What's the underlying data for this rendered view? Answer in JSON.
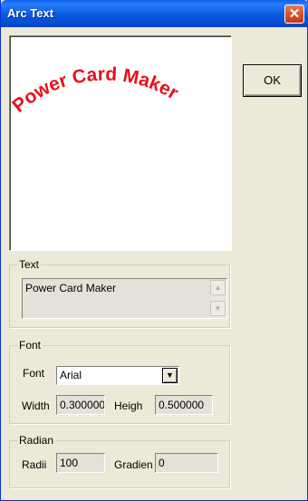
{
  "window": {
    "title": "Arc Text",
    "close_symbol": "✕"
  },
  "preview": {
    "arc_text": "Power Card Maker",
    "text_color": "#e8111b"
  },
  "ok_button": {
    "label": "OK"
  },
  "text_group": {
    "title": "Text",
    "value": "Power Card Maker",
    "scroll_up_icon": "scroll-up-arrow",
    "scroll_down_icon": "scroll-down-arrow"
  },
  "font_group": {
    "title": "Font",
    "font_label": "Font",
    "font_value": "Arial",
    "dropdown_icon": "dropdown-arrow",
    "width_label": "Width",
    "width_value": "0.300000",
    "height_label": "Height",
    "height_value": "0.500000"
  },
  "radian_group": {
    "title": "Radian",
    "radii_label": "Radii",
    "radii_value": "100",
    "gradient_label": "Gradient",
    "gradient_value": "0"
  }
}
